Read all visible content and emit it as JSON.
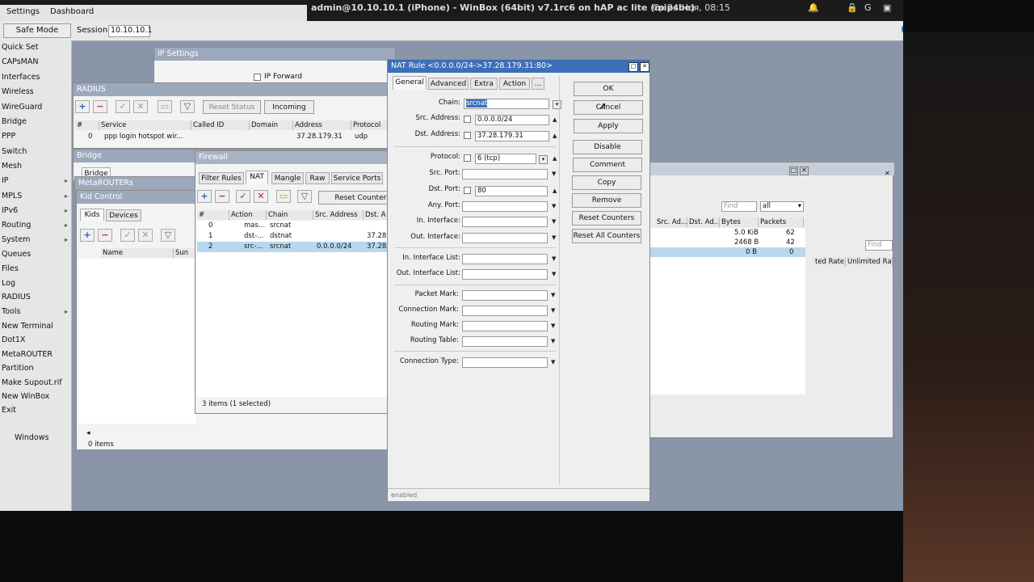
{
  "os_bar": {
    "title": "admin@10.10.10.1 (iPhone) - WinBox (64bit) v7.1rc6 on hAP ac lite (mipsbe)",
    "clock": "Ср 24 Ноя, 08:15"
  },
  "menubar": {
    "settings": "Settings",
    "dashboard": "Dashboard"
  },
  "toolbar": {
    "safe_mode": "Safe Mode",
    "session_label": "Session:",
    "session_value": "10.10.10.1"
  },
  "sidebar": {
    "items": [
      {
        "label": "Quick Set"
      },
      {
        "label": "CAPsMAN"
      },
      {
        "label": "Interfaces"
      },
      {
        "label": "Wireless"
      },
      {
        "label": "WireGuard"
      },
      {
        "label": "Bridge"
      },
      {
        "label": "PPP"
      },
      {
        "label": "Switch"
      },
      {
        "label": "Mesh"
      },
      {
        "label": "IP"
      },
      {
        "label": "MPLS"
      },
      {
        "label": "IPv6"
      },
      {
        "label": "Routing"
      },
      {
        "label": "System"
      },
      {
        "label": "Queues"
      },
      {
        "label": "Files"
      },
      {
        "label": "Log"
      },
      {
        "label": "RADIUS"
      },
      {
        "label": "Tools"
      },
      {
        "label": "New Terminal"
      },
      {
        "label": "Dot1X"
      },
      {
        "label": "MetaROUTER"
      },
      {
        "label": "Partition"
      },
      {
        "label": "Make Supout.rif"
      },
      {
        "label": "New WinBox"
      },
      {
        "label": "Exit"
      }
    ],
    "windows": "Windows"
  },
  "ip_settings": {
    "title": "IP Settings",
    "ip_forward": "IP Forward"
  },
  "radius": {
    "title": "RADIUS",
    "reset_status": "Reset Status",
    "incoming": "Incoming",
    "columns": [
      "#",
      "Service",
      "Called ID",
      "Domain",
      "Address",
      "Protocol"
    ],
    "row": {
      "num": "0",
      "service": "ppp login hotspot wir...",
      "address": "37.28.179.31",
      "protocol": "udp"
    }
  },
  "bridge": {
    "title": "Bridge",
    "tab": "Bridge"
  },
  "metarouters": {
    "title": "MetaROUTERs"
  },
  "kid_control": {
    "title": "Kid Control",
    "tabs": [
      "Kids",
      "Devices"
    ],
    "columns": [
      "Name",
      "Sun"
    ],
    "status": "0 items"
  },
  "firewall": {
    "title": "Firewall",
    "tabs": [
      "Filter Rules",
      "NAT",
      "Mangle",
      "Raw",
      "Service Ports"
    ],
    "reset_counters": "Reset Counters",
    "columns": [
      "#",
      "Action",
      "Chain",
      "Src. Address",
      "Dst. A"
    ],
    "rows": [
      {
        "num": "0",
        "action": "mas...",
        "chain": "srcnat",
        "src": "",
        "dst": ""
      },
      {
        "num": "1",
        "action": "dst-...",
        "chain": "dstnat",
        "src": "",
        "dst": "37.28"
      },
      {
        "num": "2",
        "action": "src-...",
        "chain": "srcnat",
        "src": "0.0.0.0/24",
        "dst": "37.28"
      }
    ],
    "status": "3 items (1 selected)"
  },
  "nat_rule": {
    "title": "NAT Rule <0.0.0.0/24->37.28.179.31:80>",
    "tabs": [
      "General",
      "Advanced",
      "Extra",
      "Action",
      "..."
    ],
    "fields": {
      "chain": {
        "label": "Chain:",
        "value": "srcnat"
      },
      "src_address": {
        "label": "Src. Address:",
        "value": "0.0.0.0/24"
      },
      "dst_address": {
        "label": "Dst. Address:",
        "value": "37.28.179.31"
      },
      "protocol": {
        "label": "Protocol:",
        "value": "6 (tcp)"
      },
      "src_port": {
        "label": "Src. Port:",
        "value": ""
      },
      "dst_port": {
        "label": "Dst. Port:",
        "value": "80"
      },
      "any_port": {
        "label": "Any. Port:",
        "value": ""
      },
      "in_interface": {
        "label": "In. Interface:",
        "value": ""
      },
      "out_interface": {
        "label": "Out. Interface:",
        "value": ""
      },
      "in_interface_list": {
        "label": "In. Interface List:",
        "value": ""
      },
      "out_interface_list": {
        "label": "Out. Interface List:",
        "value": ""
      },
      "packet_mark": {
        "label": "Packet Mark:",
        "value": ""
      },
      "connection_mark": {
        "label": "Connection Mark:",
        "value": ""
      },
      "routing_mark": {
        "label": "Routing Mark:",
        "value": ""
      },
      "routing_table": {
        "label": "Routing Table:",
        "value": ""
      },
      "connection_type": {
        "label": "Connection Type:",
        "value": ""
      }
    },
    "buttons": {
      "ok": "OK",
      "cancel": "Cancel",
      "apply": "Apply",
      "disable": "Disable",
      "comment": "Comment",
      "copy": "Copy",
      "remove": "Remove",
      "reset_counters": "Reset Counters",
      "reset_all_counters": "Reset All Counters"
    },
    "status": "enabled"
  },
  "right_table": {
    "find_placeholder": "Find",
    "filter_value": "all",
    "find2_placeholder": "Find",
    "columns": [
      "Src. Ad...",
      "Dst. Ad...",
      "Bytes",
      "Packets"
    ],
    "rows": [
      {
        "bytes": "5.0 KiB",
        "packets": "62"
      },
      {
        "bytes": "2468 B",
        "packets": "42"
      },
      {
        "bytes": "0 B",
        "packets": "0"
      }
    ],
    "rate1": "ted Rate Tue",
    "rate2": "Unlimited Rate"
  }
}
